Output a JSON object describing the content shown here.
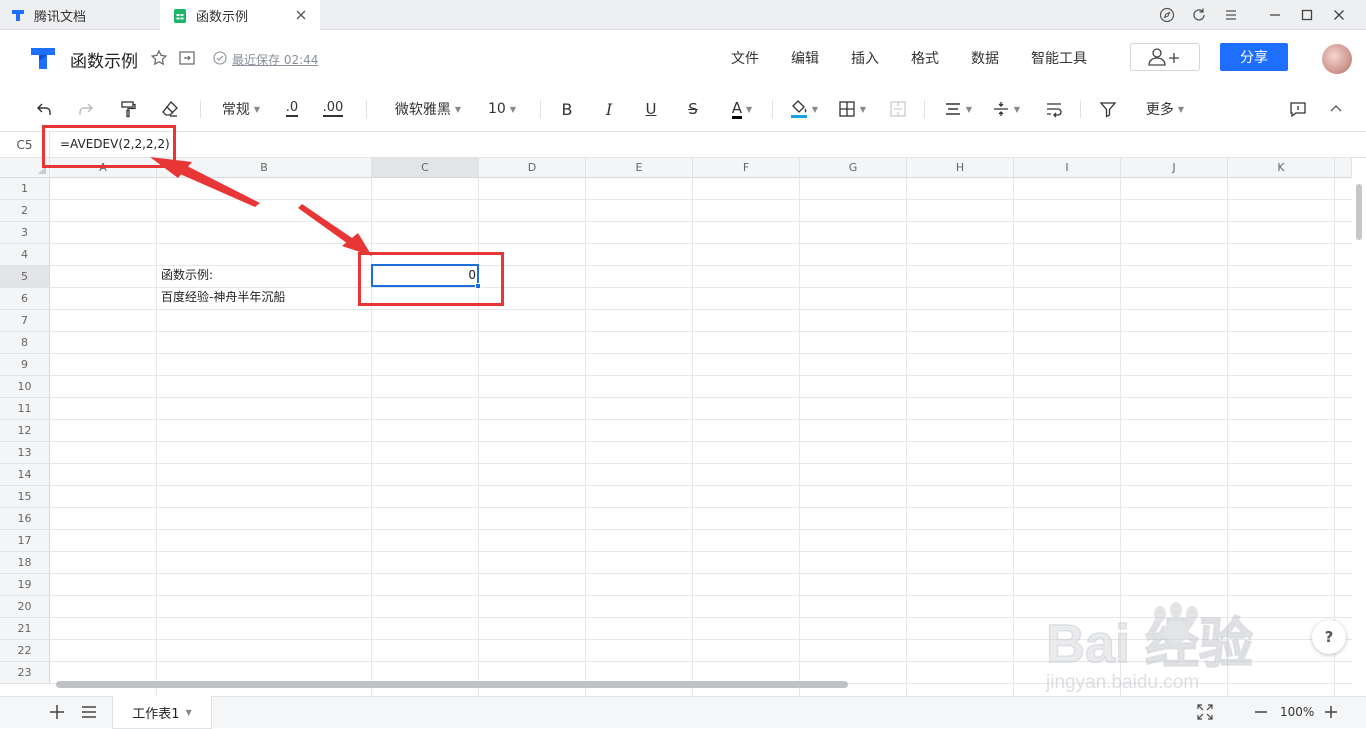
{
  "tabs": [
    {
      "label": "腾讯文档"
    },
    {
      "label": "函数示例"
    }
  ],
  "header": {
    "doc_title": "函数示例",
    "save_status": "最近保存 02:44",
    "menus": [
      "文件",
      "编辑",
      "插入",
      "格式",
      "数据",
      "智能工具"
    ],
    "share_label": "分享"
  },
  "toolbar": {
    "number_format": "常规",
    "decimal_decrease": ".0",
    "decimal_increase": ".00",
    "font_family": "微软雅黑",
    "font_size": "10",
    "bold": "B",
    "italic": "I",
    "underline": "U",
    "strike": "S",
    "font_color": "A",
    "more_label": "更多",
    "text_color_hex": "#000000",
    "fill_color_hex": "#1aa0e6"
  },
  "formula_bar": {
    "cell_ref": "C5",
    "formula": "=AVEDEV(2,2,2,2)"
  },
  "sheet": {
    "columns": [
      "A",
      "B",
      "C",
      "D",
      "E",
      "F",
      "G",
      "H",
      "I",
      "J",
      "K"
    ],
    "rows": [
      "1",
      "2",
      "3",
      "4",
      "5",
      "6",
      "7",
      "8",
      "9",
      "10",
      "11",
      "12",
      "13",
      "14",
      "15",
      "16",
      "17",
      "18",
      "19",
      "20",
      "21",
      "22",
      "23"
    ],
    "cells": {
      "B5": "函数示例:",
      "B6": "百度经验-神舟半年沉船",
      "C5": "0"
    },
    "selected_cell": "C5"
  },
  "footer": {
    "sheet_name": "工作表1",
    "zoom": "100%"
  },
  "watermark": {
    "brand": "Bai 经验",
    "url": "jingyan.baidu.com"
  },
  "help_label": "?",
  "colors": {
    "accent": "#1e6fff",
    "annotation": "#e83535",
    "selection": "#1e6fd9"
  }
}
